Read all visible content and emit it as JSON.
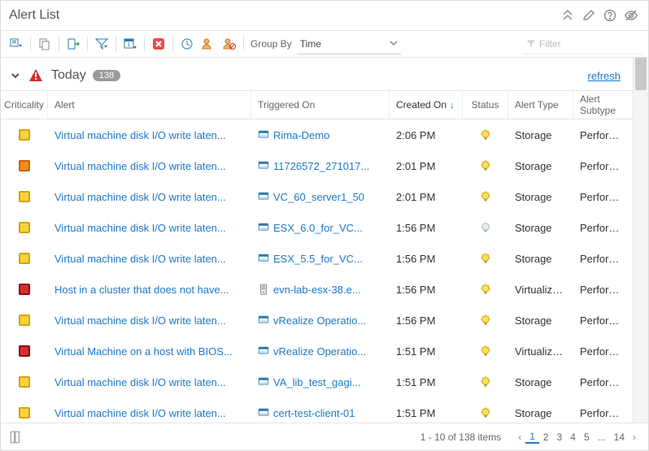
{
  "header": {
    "title": "Alert List"
  },
  "toolbar": {
    "group_by_label": "Group By",
    "group_by_value": "Time",
    "filter_placeholder": "Filter"
  },
  "group": {
    "label": "Today",
    "count": "138",
    "refresh": "refresh"
  },
  "columns": {
    "criticality": "Criticality",
    "alert": "Alert",
    "triggered": "Triggered On",
    "created": "Created On",
    "status": "Status",
    "type": "Alert Type",
    "subtype": "Alert Subtype"
  },
  "rows": [
    {
      "criticality": "yellow",
      "alert": "Virtual machine disk I/O write laten...",
      "icon": "vm",
      "triggered": "Rima-Demo",
      "created": "2:06 PM",
      "status": "on",
      "type": "Storage",
      "subtype": "Performa..."
    },
    {
      "criticality": "orange",
      "alert": "Virtual machine disk I/O write laten...",
      "icon": "vm",
      "triggered": "11726572_271017...",
      "created": "2:01 PM",
      "status": "on",
      "type": "Storage",
      "subtype": "Performa..."
    },
    {
      "criticality": "yellow",
      "alert": "Virtual machine disk I/O write laten...",
      "icon": "vm",
      "triggered": "VC_60_server1_50",
      "created": "2:01 PM",
      "status": "on",
      "type": "Storage",
      "subtype": "Performa..."
    },
    {
      "criticality": "yellow",
      "alert": "Virtual machine disk I/O write laten...",
      "icon": "vm",
      "triggered": "ESX_6.0_for_VC...",
      "created": "1:56 PM",
      "status": "off",
      "type": "Storage",
      "subtype": "Performa..."
    },
    {
      "criticality": "yellow",
      "alert": "Virtual machine disk I/O write laten...",
      "icon": "vm",
      "triggered": "ESX_5.5_for_VC...",
      "created": "1:56 PM",
      "status": "on",
      "type": "Storage",
      "subtype": "Performa..."
    },
    {
      "criticality": "red",
      "alert": "Host in a cluster that does not have...",
      "icon": "host",
      "triggered": "evn-lab-esx-38.e...",
      "created": "1:56 PM",
      "status": "on",
      "type": "Virtualiza...",
      "subtype": "Performa..."
    },
    {
      "criticality": "yellow",
      "alert": "Virtual machine disk I/O write laten...",
      "icon": "vm",
      "triggered": "vRealize Operatio...",
      "created": "1:56 PM",
      "status": "on",
      "type": "Storage",
      "subtype": "Performa..."
    },
    {
      "criticality": "red",
      "alert": "Virtual Machine on a host with BIOS...",
      "icon": "vm",
      "triggered": "vRealize Operatio...",
      "created": "1:51 PM",
      "status": "on",
      "type": "Virtualiza...",
      "subtype": "Performa..."
    },
    {
      "criticality": "yellow",
      "alert": "Virtual machine disk I/O write laten...",
      "icon": "vm",
      "triggered": "VA_lib_test_gagi...",
      "created": "1:51 PM",
      "status": "on",
      "type": "Storage",
      "subtype": "Performa..."
    },
    {
      "criticality": "yellow",
      "alert": "Virtual machine disk I/O write laten...",
      "icon": "vm",
      "triggered": "cert-test-client-01",
      "created": "1:51 PM",
      "status": "on",
      "type": "Storage",
      "subtype": "Performa..."
    }
  ],
  "footer": {
    "range": "1 - 10 of 138 items",
    "pages": [
      "1",
      "2",
      "3",
      "4",
      "5",
      "...",
      "14"
    ],
    "current_page": "1"
  }
}
